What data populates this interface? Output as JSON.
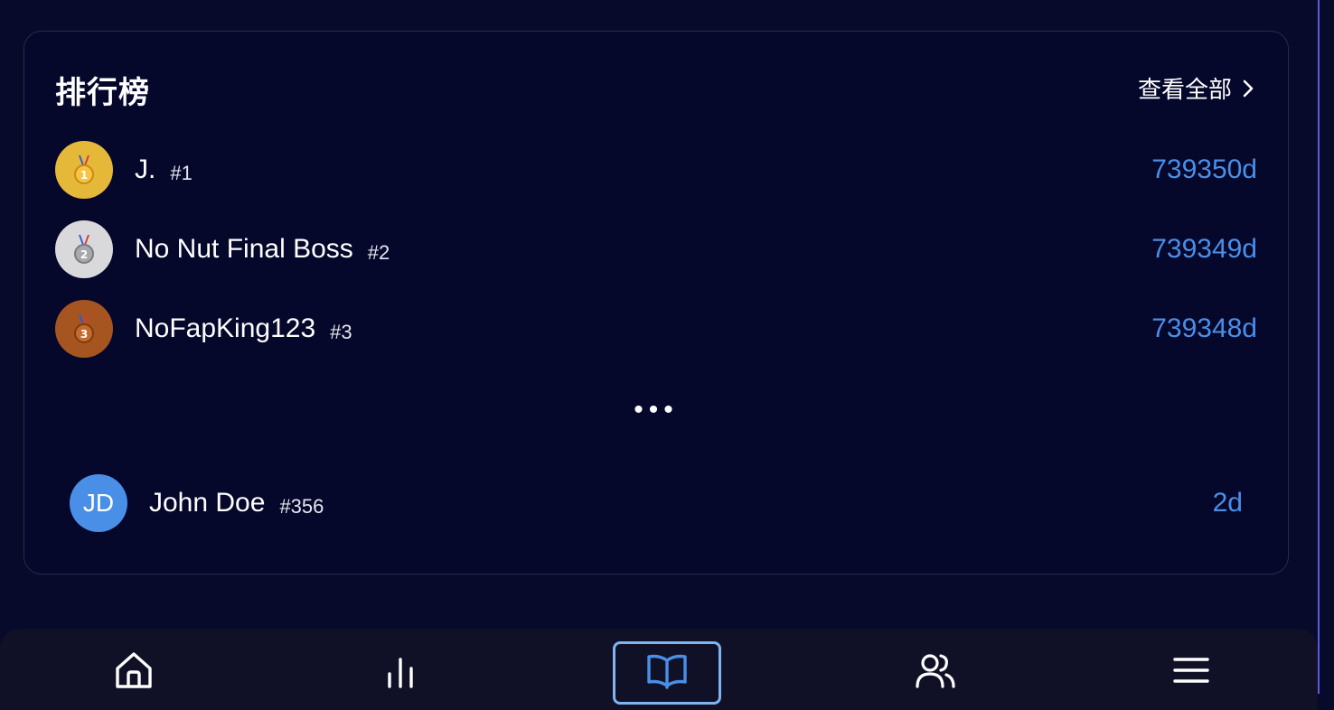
{
  "leaderboard": {
    "title": "排行榜",
    "view_all": "查看全部",
    "ellipsis": "•••",
    "top": [
      {
        "medal_number": "1",
        "medal_color": "#e6b83a",
        "name": "J.",
        "rank": "#1",
        "score": "739350d"
      },
      {
        "medal_number": "2",
        "medal_color": "#d9d9dc",
        "name": "No Nut Final Boss",
        "rank": "#2",
        "score": "739349d"
      },
      {
        "medal_number": "3",
        "medal_color": "#a65521",
        "name": "NoFapKing123",
        "rank": "#3",
        "score": "739348d"
      }
    ],
    "me": {
      "initials": "JD",
      "name": "John Doe",
      "rank": "#356",
      "score": "2d"
    }
  },
  "nav": {
    "items": [
      {
        "icon": "home-icon",
        "active": false
      },
      {
        "icon": "bar-chart-icon",
        "active": false
      },
      {
        "icon": "book-icon",
        "active": true
      },
      {
        "icon": "users-icon",
        "active": false
      },
      {
        "icon": "menu-icon",
        "active": false
      }
    ]
  },
  "colors": {
    "background": "#070a2b",
    "accent": "#4a8fe7",
    "nav_active_border": "#7fb4f0"
  }
}
